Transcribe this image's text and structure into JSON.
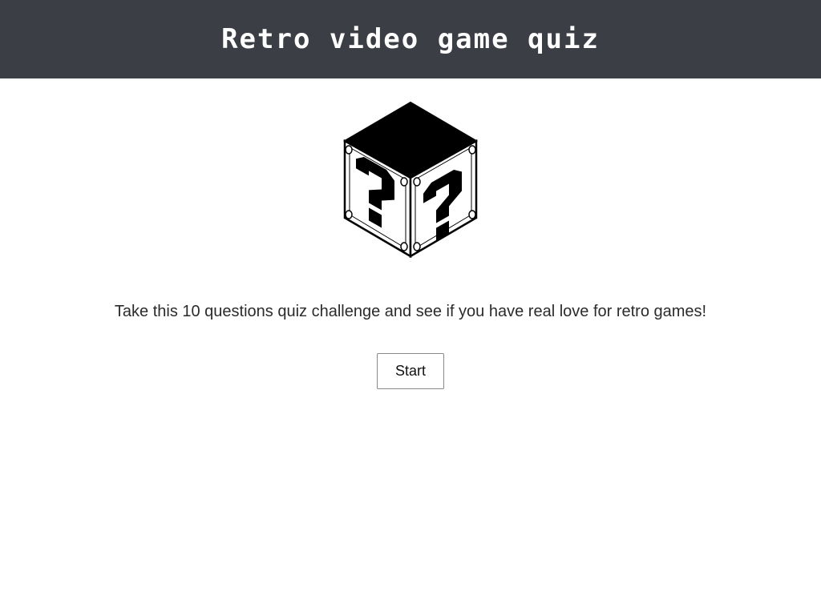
{
  "header": {
    "title": "Retro video game quiz",
    "background_color": "#3b3e45"
  },
  "main": {
    "image": {
      "icon": "question-block-cube-icon"
    },
    "intro_text": "Take this 10 questions quiz challenge and see if you have real love for retro games!",
    "start_button_label": "Start"
  }
}
